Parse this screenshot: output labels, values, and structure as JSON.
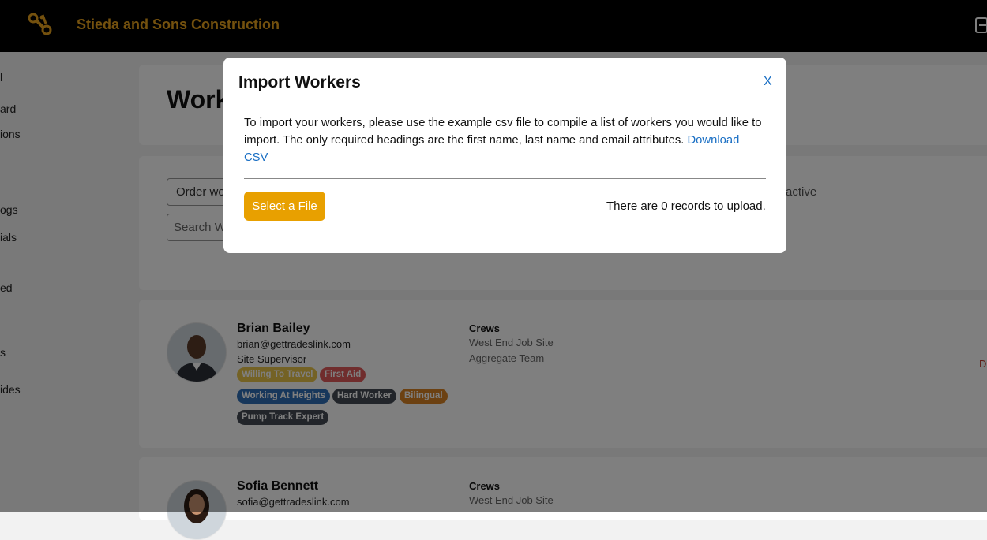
{
  "header": {
    "app_title": "Stieda and Sons Construction",
    "brand_color": "#e8a21c"
  },
  "sidebar": {
    "items": [
      {
        "label": "l"
      },
      {
        "label": "ard"
      },
      {
        "label": "ions"
      },
      {
        "label": "ogs"
      },
      {
        "label": "ials"
      },
      {
        "label": "ed"
      },
      {
        "label": "s"
      },
      {
        "label": "ides"
      }
    ]
  },
  "page": {
    "title": "Work",
    "order_select": "Order wo",
    "search_placeholder": "Search W",
    "inactive_label": "active"
  },
  "workers": [
    {
      "name": "Brian Bailey",
      "email": "brian@gettradeslink.com",
      "role": "Site Supervisor",
      "crews_header": "Crews",
      "crews": [
        "West End Job Site",
        "Aggregate Team"
      ],
      "tags": [
        {
          "label": "Willing To Travel",
          "color": "#e8c44a"
        },
        {
          "label": "First Aid",
          "color": "#e05a5a"
        },
        {
          "label": "Working At Heights",
          "color": "#2f6fb7"
        },
        {
          "label": "Hard Worker",
          "color": "#444b54"
        },
        {
          "label": "Bilingual",
          "color": "#d98324"
        },
        {
          "label": "Pump Track Expert",
          "color": "#444b54"
        }
      ],
      "action": "D"
    },
    {
      "name": "Sofia Bennett",
      "email": "sofia@gettradeslink.com",
      "crews_header": "Crews",
      "crews": [
        "West End Job Site"
      ]
    }
  ],
  "modal": {
    "title": "Import Workers",
    "close_label": "X",
    "text": "To import your workers, please use the example csv file to compile a list of workers you would like to import. The only required headings are the first name, last name and email attributes.",
    "link_label": "Download CSV",
    "button_label": "Select a File",
    "records_text": "There are 0 records to upload.",
    "button_color": "#e8a000",
    "link_color": "#1a6fc4"
  }
}
